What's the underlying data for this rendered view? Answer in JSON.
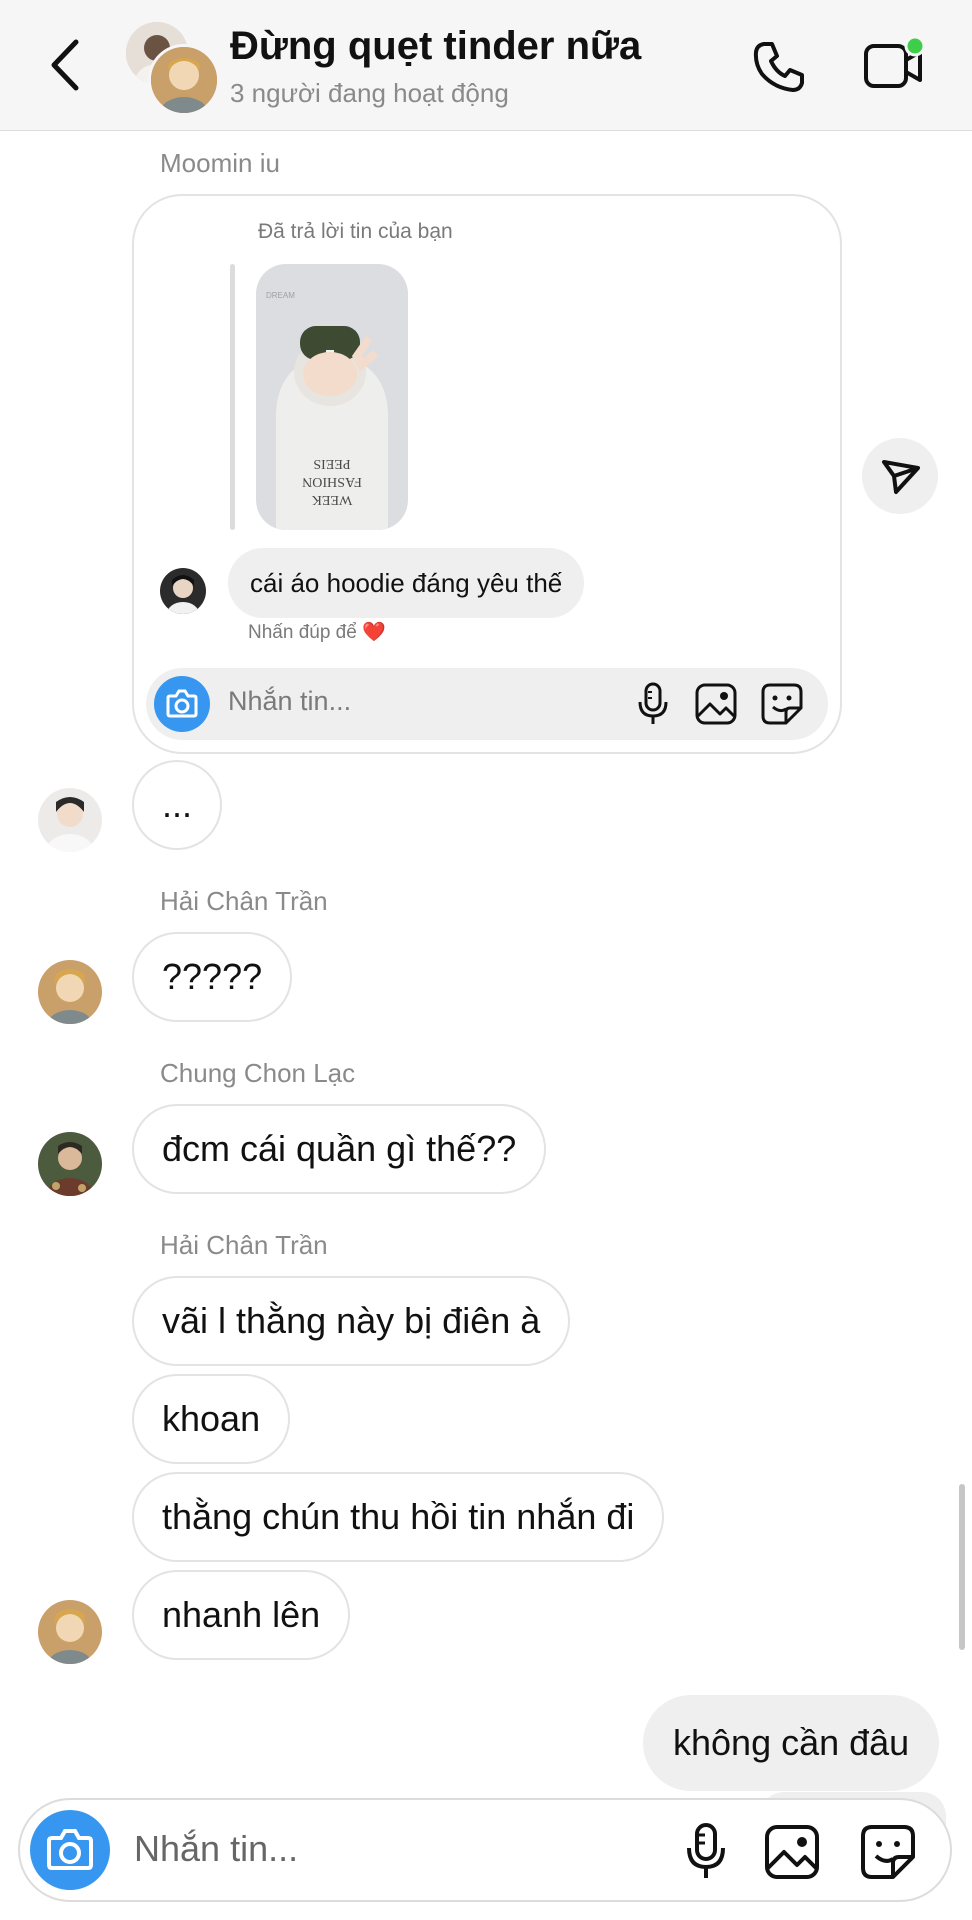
{
  "header": {
    "title": "Đừng quẹt tinder nữa",
    "subtitle": "3 người đang hoạt động"
  },
  "story_reply": {
    "sender": "Moomin iu",
    "reply_label": "Đã trả lời tin của bạn",
    "story_text": [
      "DREAM",
      "PEEIS",
      "FASHION",
      "WEEK"
    ],
    "message": "cái áo hoodie đáng yêu thế",
    "hint": "Nhấn đúp để ❤️",
    "input_placeholder": "Nhắn tin..."
  },
  "messages": [
    {
      "text": "..."
    },
    {
      "sender": "Hải Chân Trần",
      "text": "?????"
    },
    {
      "sender": "Chung Chon Lạc",
      "text": "đcm cái quần gì thế??"
    },
    {
      "sender": "Hải Chân Trần",
      "text": "vãi l thằng này bị điên à"
    },
    {
      "text": "khoan"
    },
    {
      "text": "thằng chún thu hồi tin nhắn đi"
    },
    {
      "text": "nhanh lên"
    }
  ],
  "own_message": "không cần đâu",
  "composer": {
    "placeholder": "Nhắn tin..."
  },
  "colors": {
    "accent": "#3797f0",
    "online": "#3ecf4a",
    "bubble_border": "#e3e3e3",
    "own_bubble": "#efefef"
  },
  "icons": [
    "chevron-left-icon",
    "phone-icon",
    "video-camera-icon",
    "send-icon",
    "camera-icon",
    "microphone-icon",
    "image-icon",
    "sticker-icon"
  ]
}
